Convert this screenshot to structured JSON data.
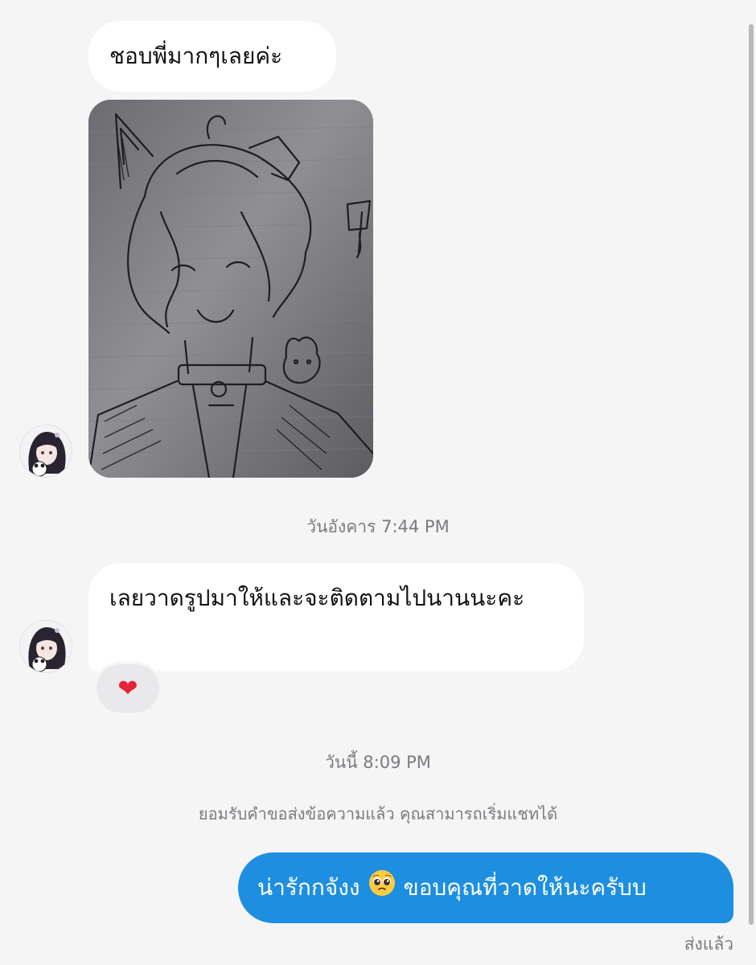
{
  "messages": {
    "incoming_1": "ชอบพี่มากๆเลยค่ะ",
    "incoming_2": "เลยวาดรูปมาให้และจะติดตามไปนานนะคะ",
    "reaction": "❤",
    "outgoing_part1": "น่ารักกจังง",
    "outgoing_emoji": "pleading-face",
    "outgoing_part2": "ขอบคุณที่วาดให้นะครับบ"
  },
  "timestamps": {
    "first": "วันอังคาร 7:44 PM",
    "second": "วันนี้ 8:09 PM"
  },
  "system_notice": "ยอมรับคำขอส่งข้อความแล้ว คุณสามารถเริ่มแชทได้",
  "status": "ส่งแล้ว",
  "icons": {
    "avatar": "avatar-icon",
    "reaction": "heart-icon",
    "emoji": "pleading-face-icon"
  },
  "colors": {
    "background": "#f5f5f6",
    "incoming_bubble": "#ffffff",
    "outgoing_bubble": "#1e8fe0",
    "meta_text": "#7b7b80",
    "reaction_heart": "#e5233b"
  }
}
